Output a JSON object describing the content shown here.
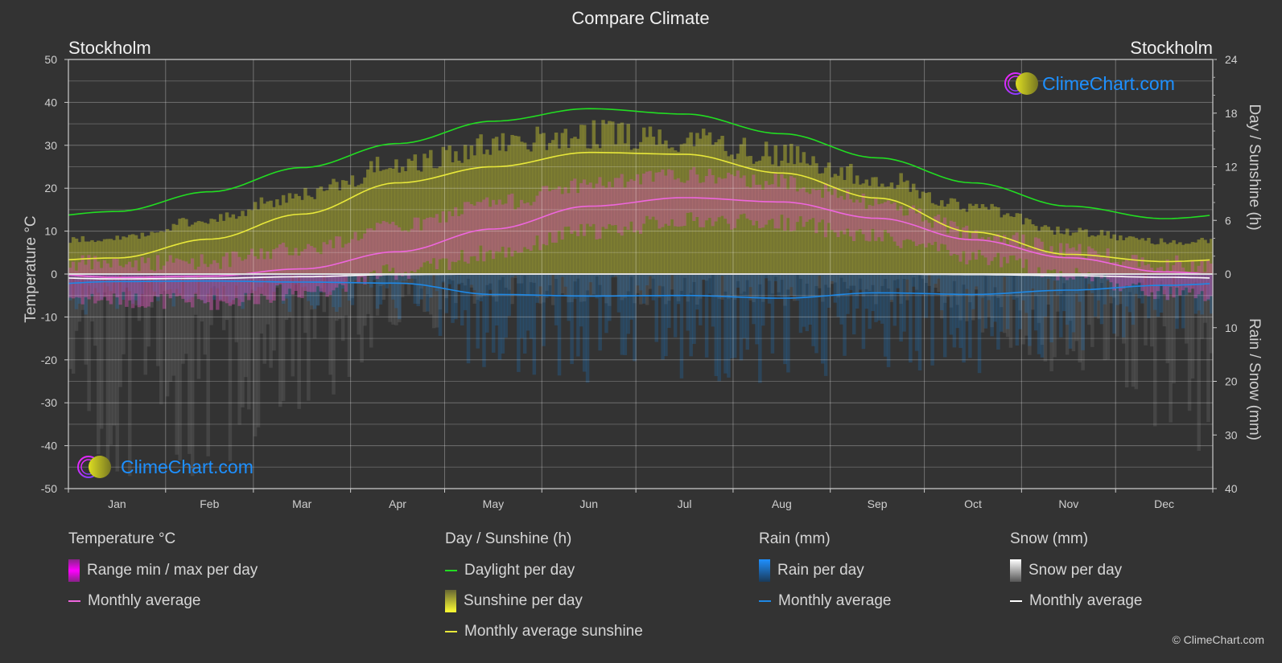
{
  "chart_data": {
    "type": "line",
    "title": "Compare Climate",
    "location_left": "Stockholm",
    "location_right": "Stockholm",
    "categories": [
      "Jan",
      "Feb",
      "Mar",
      "Apr",
      "May",
      "Jun",
      "Jul",
      "Aug",
      "Sep",
      "Oct",
      "Nov",
      "Dec"
    ],
    "y_left": {
      "label": "Temperature °C",
      "range": [
        -50,
        50
      ],
      "ticks": [
        50,
        40,
        30,
        20,
        10,
        0,
        -10,
        -20,
        -30,
        -40,
        -50
      ]
    },
    "y_right_top": {
      "label": "Day / Sunshine (h)",
      "range": [
        0,
        24
      ],
      "ticks": [
        24,
        18,
        12,
        6,
        0
      ]
    },
    "y_right_bottom": {
      "label": "Rain / Snow (mm)",
      "range": [
        0,
        40
      ],
      "ticks": [
        0,
        10,
        20,
        30,
        40
      ]
    },
    "grid": true,
    "series": [
      {
        "name": "Daylight per day",
        "axis": "sunshine",
        "color": "#22dd22",
        "values": [
          7.0,
          9.2,
          11.9,
          14.6,
          17.1,
          18.5,
          17.9,
          15.7,
          13.0,
          10.2,
          7.6,
          6.2
        ]
      },
      {
        "name": "Monthly average sunshine",
        "axis": "sunshine",
        "color": "#e8e83a",
        "values": [
          1.8,
          3.9,
          6.7,
          10.2,
          12.0,
          13.6,
          13.4,
          11.3,
          8.5,
          4.7,
          2.2,
          1.4
        ]
      },
      {
        "name": "Sunshine per day (envelope)",
        "axis": "sunshine",
        "color": "#a8a83a",
        "values": [
          4.2,
          6.5,
          9.5,
          13.0,
          15.2,
          16.5,
          16.0,
          14.0,
          11.2,
          7.8,
          5.0,
          3.8
        ]
      },
      {
        "name": "Temperature monthly average",
        "axis": "temperature",
        "color": "#ee66dd",
        "values": [
          -0.8,
          -0.5,
          1.2,
          5.2,
          10.5,
          15.8,
          17.8,
          16.8,
          13.0,
          8.0,
          3.8,
          0.5
        ]
      },
      {
        "name": "Temperature range max",
        "axis": "temperature",
        "color": "#cc66aa",
        "values": [
          2.5,
          3.0,
          6.0,
          11.0,
          16.5,
          21.0,
          23.0,
          21.5,
          16.5,
          10.0,
          5.5,
          2.5
        ]
      },
      {
        "name": "Temperature range min",
        "axis": "temperature",
        "color": "#aa44aa",
        "values": [
          -6.0,
          -6.5,
          -4.0,
          0.5,
          5.0,
          10.0,
          12.5,
          12.0,
          8.5,
          4.0,
          0.0,
          -4.5
        ]
      },
      {
        "name": "Rain monthly average",
        "axis": "precip",
        "color": "#1e88e5",
        "values": [
          1.4,
          1.3,
          1.5,
          1.7,
          3.8,
          4.1,
          4.0,
          4.5,
          3.5,
          3.8,
          3.0,
          2.1
        ]
      },
      {
        "name": "Snow monthly average",
        "axis": "precip",
        "color": "#ffffff",
        "values": [
          0.9,
          0.8,
          0.5,
          0.1,
          0.0,
          0.0,
          0.0,
          0.0,
          0.0,
          0.1,
          0.3,
          0.6
        ]
      }
    ],
    "legend": {
      "placement": "bottom",
      "groups": [
        {
          "title": "Temperature °C",
          "items": [
            {
              "label": "Range min / max per day",
              "kind": "bar",
              "color": "#ee00ee"
            },
            {
              "label": "Monthly average",
              "kind": "line",
              "color": "#ee66dd"
            }
          ]
        },
        {
          "title": "Day / Sunshine (h)",
          "items": [
            {
              "label": "Daylight per day",
              "kind": "line",
              "color": "#22dd22"
            },
            {
              "label": "Sunshine per day",
              "kind": "bar",
              "color": "#e8e83a"
            },
            {
              "label": "Monthly average sunshine",
              "kind": "line",
              "color": "#e8e83a"
            }
          ]
        },
        {
          "title": "Rain (mm)",
          "items": [
            {
              "label": "Rain per day",
              "kind": "bar",
              "color": "#1e88e5"
            },
            {
              "label": "Monthly average",
              "kind": "line",
              "color": "#1e88e5"
            }
          ]
        },
        {
          "title": "Snow (mm)",
          "items": [
            {
              "label": "Snow per day",
              "kind": "bar",
              "color": "#dddddd"
            },
            {
              "label": "Monthly average",
              "kind": "line",
              "color": "#ffffff"
            }
          ]
        }
      ]
    }
  },
  "watermark": {
    "text": "ClimeChart.com",
    "color": "#1e90ff"
  },
  "copyright": "© ClimeChart.com"
}
